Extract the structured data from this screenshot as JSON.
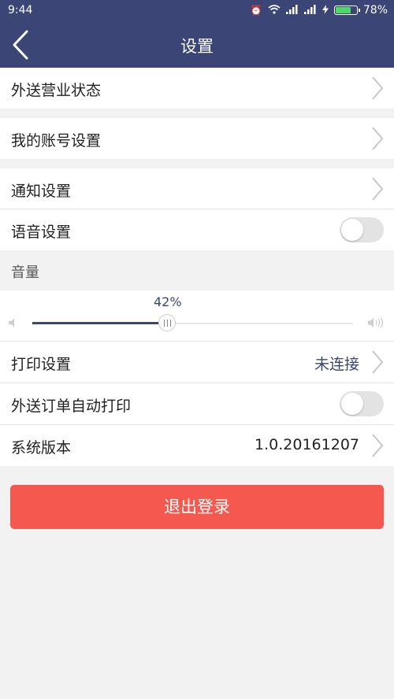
{
  "status_bar": {
    "time": "9:44",
    "battery_percent": "78%",
    "battery_level": 0.78
  },
  "header": {
    "title": "设置"
  },
  "rows": {
    "delivery_status": "外送营业状态",
    "account_settings": "我的账号设置",
    "notification_settings": "通知设置",
    "voice_settings": {
      "label": "语音设置",
      "enabled": false
    },
    "volume": {
      "section_label": "音量",
      "value_label": "42%",
      "level": 0.42
    },
    "print_settings": {
      "label": "打印设置",
      "value": "未连接"
    },
    "auto_print": {
      "label": "外送订单自动打印",
      "enabled": false
    },
    "system_version": {
      "label": "系统版本",
      "value": "1.0.20161207"
    }
  },
  "logout_button": "退出登录",
  "colors": {
    "header_bg": "#3b4576",
    "accent": "#3b4576",
    "logout_bg": "#f5584e",
    "background": "#f2f2f2"
  }
}
